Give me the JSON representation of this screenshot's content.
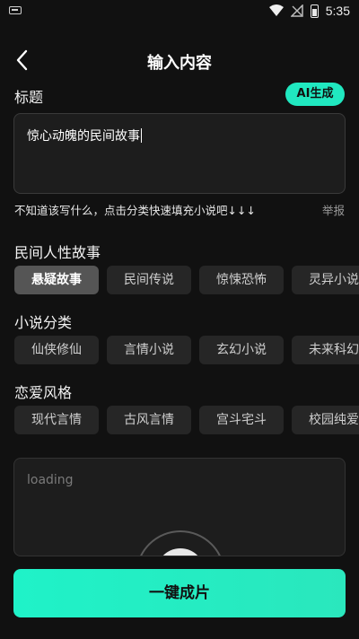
{
  "status_bar": {
    "time": "5:35"
  },
  "header": {
    "title": "输入内容"
  },
  "title_section": {
    "label": "标题",
    "ai_button": "AI生成",
    "input_value": "惊心动魄的民间故事"
  },
  "hint": {
    "text": "不知道该写什么，点击分类快速填充小说吧↓↓↓",
    "report": "举报"
  },
  "folk": {
    "label": "民间人性故事",
    "chips": [
      "悬疑故事",
      "民间传说",
      "惊悚恐怖",
      "灵异小说"
    ],
    "selected": "悬疑故事"
  },
  "novel": {
    "label": "小说分类",
    "chips": [
      "仙侠修仙",
      "言情小说",
      "玄幻小说",
      "未来科幻"
    ]
  },
  "romance": {
    "label": "恋爱风格",
    "chips": [
      "现代言情",
      "古风言情",
      "宫斗宅斗",
      "校园纯爱"
    ]
  },
  "preview": {
    "loading_text": "loading"
  },
  "cta": {
    "label": "一键成片"
  },
  "colors": {
    "accent": "#20e8c0",
    "background": "#111111",
    "chip": "#262626",
    "chip_selected": "#555555"
  }
}
